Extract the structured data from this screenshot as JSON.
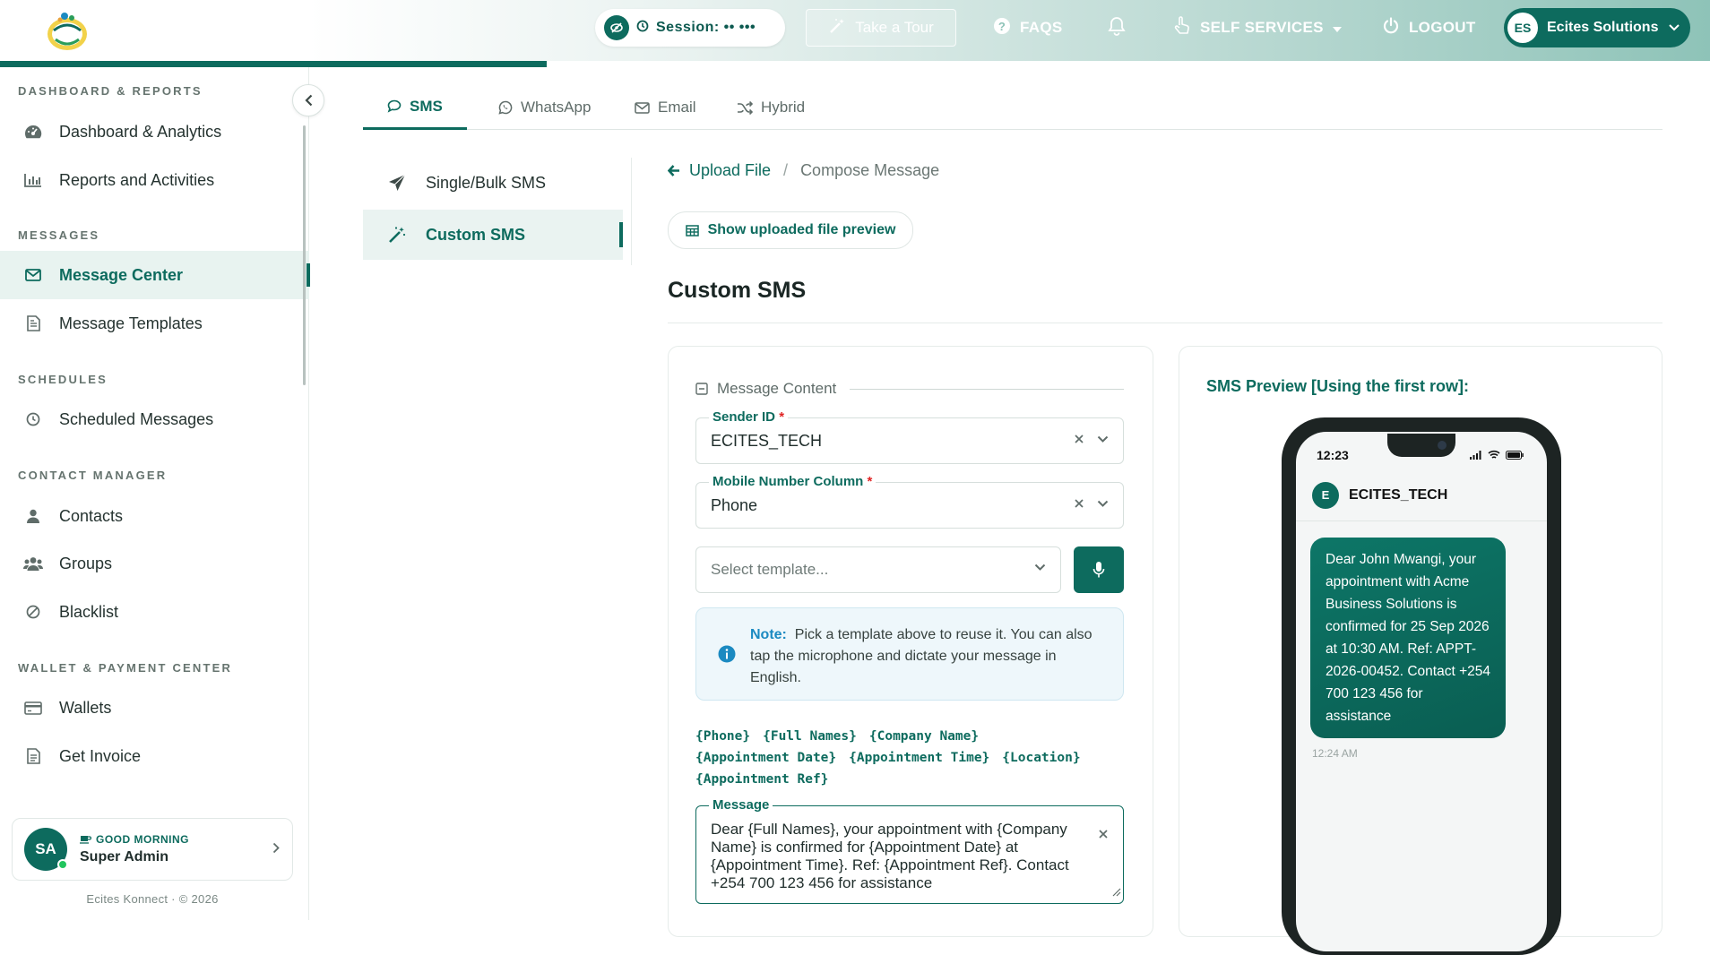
{
  "header": {
    "session_label": "Session: •• •••",
    "tour_label": "Take a Tour",
    "faqs_label": "FAQS",
    "self_services_label": "SELF SERVICES",
    "logout_label": "LOGOUT",
    "user_initials": "ES",
    "user_name": "Ecites Solutions",
    "icons": [
      "eye-slash-icon",
      "clock-icon",
      "magic-wand-icon",
      "question-circle-icon",
      "bell-icon",
      "hand-pointer-icon",
      "caret-down-icon",
      "power-icon",
      "chevron-down-icon"
    ]
  },
  "sidebar": {
    "sections": [
      {
        "title": "DASHBOARD & REPORTS",
        "items": [
          {
            "label": "Dashboard & Analytics",
            "icon": "gauge-icon"
          },
          {
            "label": "Reports and Activities",
            "icon": "bar-chart-icon"
          }
        ]
      },
      {
        "title": "MESSAGES",
        "items": [
          {
            "label": "Message Center",
            "icon": "envelope-icon",
            "active": true
          },
          {
            "label": "Message Templates",
            "icon": "file-text-icon"
          }
        ]
      },
      {
        "title": "SCHEDULES",
        "items": [
          {
            "label": "Scheduled Messages",
            "icon": "clock-icon"
          }
        ]
      },
      {
        "title": "CONTACT MANAGER",
        "items": [
          {
            "label": "Contacts",
            "icon": "user-icon"
          },
          {
            "label": "Groups",
            "icon": "users-icon"
          },
          {
            "label": "Blacklist",
            "icon": "ban-icon"
          }
        ]
      },
      {
        "title": "WALLET & PAYMENT CENTER",
        "items": [
          {
            "label": "Wallets",
            "icon": "credit-card-icon"
          },
          {
            "label": "Get Invoice",
            "icon": "invoice-icon"
          }
        ]
      }
    ],
    "user": {
      "initials": "SA",
      "greeting": "GOOD MORNING",
      "name": "Super Admin"
    },
    "copyright": "Ecites Konnect · © 2026"
  },
  "tabs": [
    {
      "label": "SMS",
      "icon": "comment-icon",
      "active": true
    },
    {
      "label": "WhatsApp",
      "icon": "whatsapp-icon"
    },
    {
      "label": "Email",
      "icon": "envelope-icon"
    },
    {
      "label": "Hybrid",
      "icon": "shuffle-icon"
    }
  ],
  "submenu": [
    {
      "label": "Single/Bulk SMS",
      "icon": "paper-plane-icon"
    },
    {
      "label": "Custom SMS",
      "icon": "magic-wand-icon",
      "active": true
    }
  ],
  "breadcrumb": {
    "back_label": "Upload File",
    "current": "Compose Message"
  },
  "preview_button_label": "Show uploaded file preview",
  "page_title": "Custom SMS",
  "form": {
    "legend": "Message Content",
    "sender_label": "Sender ID",
    "sender_value": "ECITES_TECH",
    "mobile_label": "Mobile Number Column",
    "mobile_value": "Phone",
    "template_placeholder": "Select template...",
    "note_label": "Note:",
    "note_text": "Pick a template above to reuse it. You can also tap the microphone and dictate your message in English.",
    "placeholders": [
      "{Phone}",
      "{Full Names}",
      "{Company Name}",
      "{Appointment Date}",
      "{Appointment Time}",
      "{Location}",
      "{Appointment Ref}"
    ],
    "message_label": "Message",
    "message_value": "Dear {Full Names}, your appointment with {Company Name} is confirmed for {Appointment Date} at {Appointment Time}. Ref: {Appointment Ref}. Contact +254 700 123 456 for assistance"
  },
  "preview": {
    "title": "SMS Preview [Using the first row]:",
    "status_time": "12:23",
    "sender_initial": "E",
    "sender": "ECITES_TECH",
    "message": "Dear John Mwangi, your appointment with Acme Business Solutions is confirmed for 25 Sep 2026 at 10:30 AM. Ref: APPT-2026-00452. Contact +254 700 123 456 for assistance",
    "message_time": "12:24 AM"
  },
  "colors": {
    "brand": "#0d6b5e",
    "info": "#1b8ac1",
    "required": "#e02424"
  }
}
